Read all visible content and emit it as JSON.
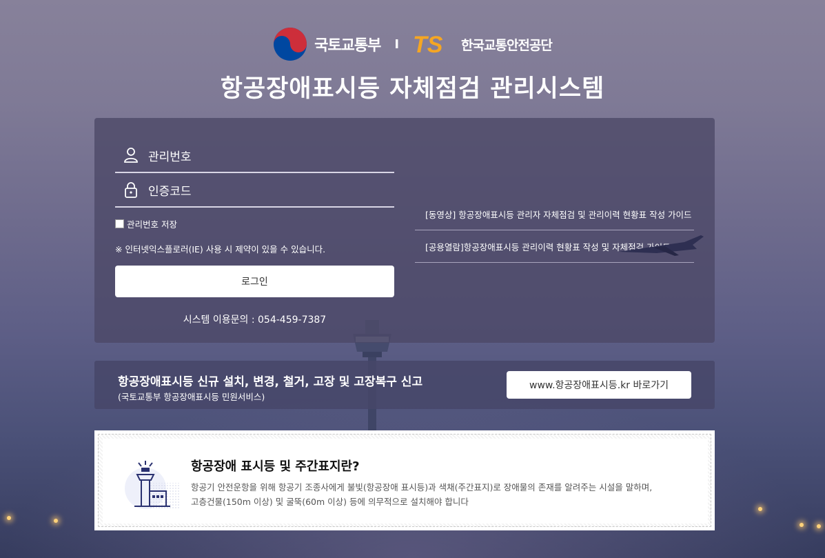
{
  "header": {
    "ministry_name": "국토교통부",
    "separator": "I",
    "ts_mark": "TS",
    "agency_name": "한국교통안전공단",
    "main_title": "항공장애표시등 자체점검 관리시스템"
  },
  "login": {
    "id_placeholder": "관리번호",
    "code_placeholder": "인증코드",
    "remember_label": "관리번호 저장",
    "ie_notice": "※ 인터넷익스플로러(IE) 사용 시 제약이 있을 수 있습니다.",
    "login_button": "로그인",
    "contact": "시스템 이용문의 : 054-459-7387"
  },
  "guides": [
    {
      "label": "[동영상] 항공장애표시등 관리자 자체점검 및 관리이력 현황표 작성 가이드"
    },
    {
      "label": "[공용열람]항공장애표시등 관리이력 현황표 작성 및 자체점검 가이드",
      "chevron": "›"
    }
  ],
  "report": {
    "title": "항공장애표시등 신규 설치, 변경, 철거, 고장 및 고장복구 신고",
    "subtitle": "(국토교통부 항공장애표시등 민원서비스)",
    "button": "www.항공장애표시등.kr 바로가기"
  },
  "info": {
    "title": "항공장애 표시등 및 주간표지란?",
    "line1": "항공기 안전운항을 위해 항공기 조종사에게 불빛(항공장애 표시등)과 색채(주간표지)로 장애물의 존재를 알려주는 시설을 말하며,",
    "line2": "고층건물(150m 이상) 및 굴뚝(60m 이상) 등에 의무적으로 설치해야 합니다"
  },
  "colors": {
    "panel": "#4b4867",
    "ts_orange": "#f5a623",
    "ts_blue": "#1f8fd8",
    "taeguk_red": "#cd2e3a",
    "taeguk_blue": "#0047a0"
  }
}
